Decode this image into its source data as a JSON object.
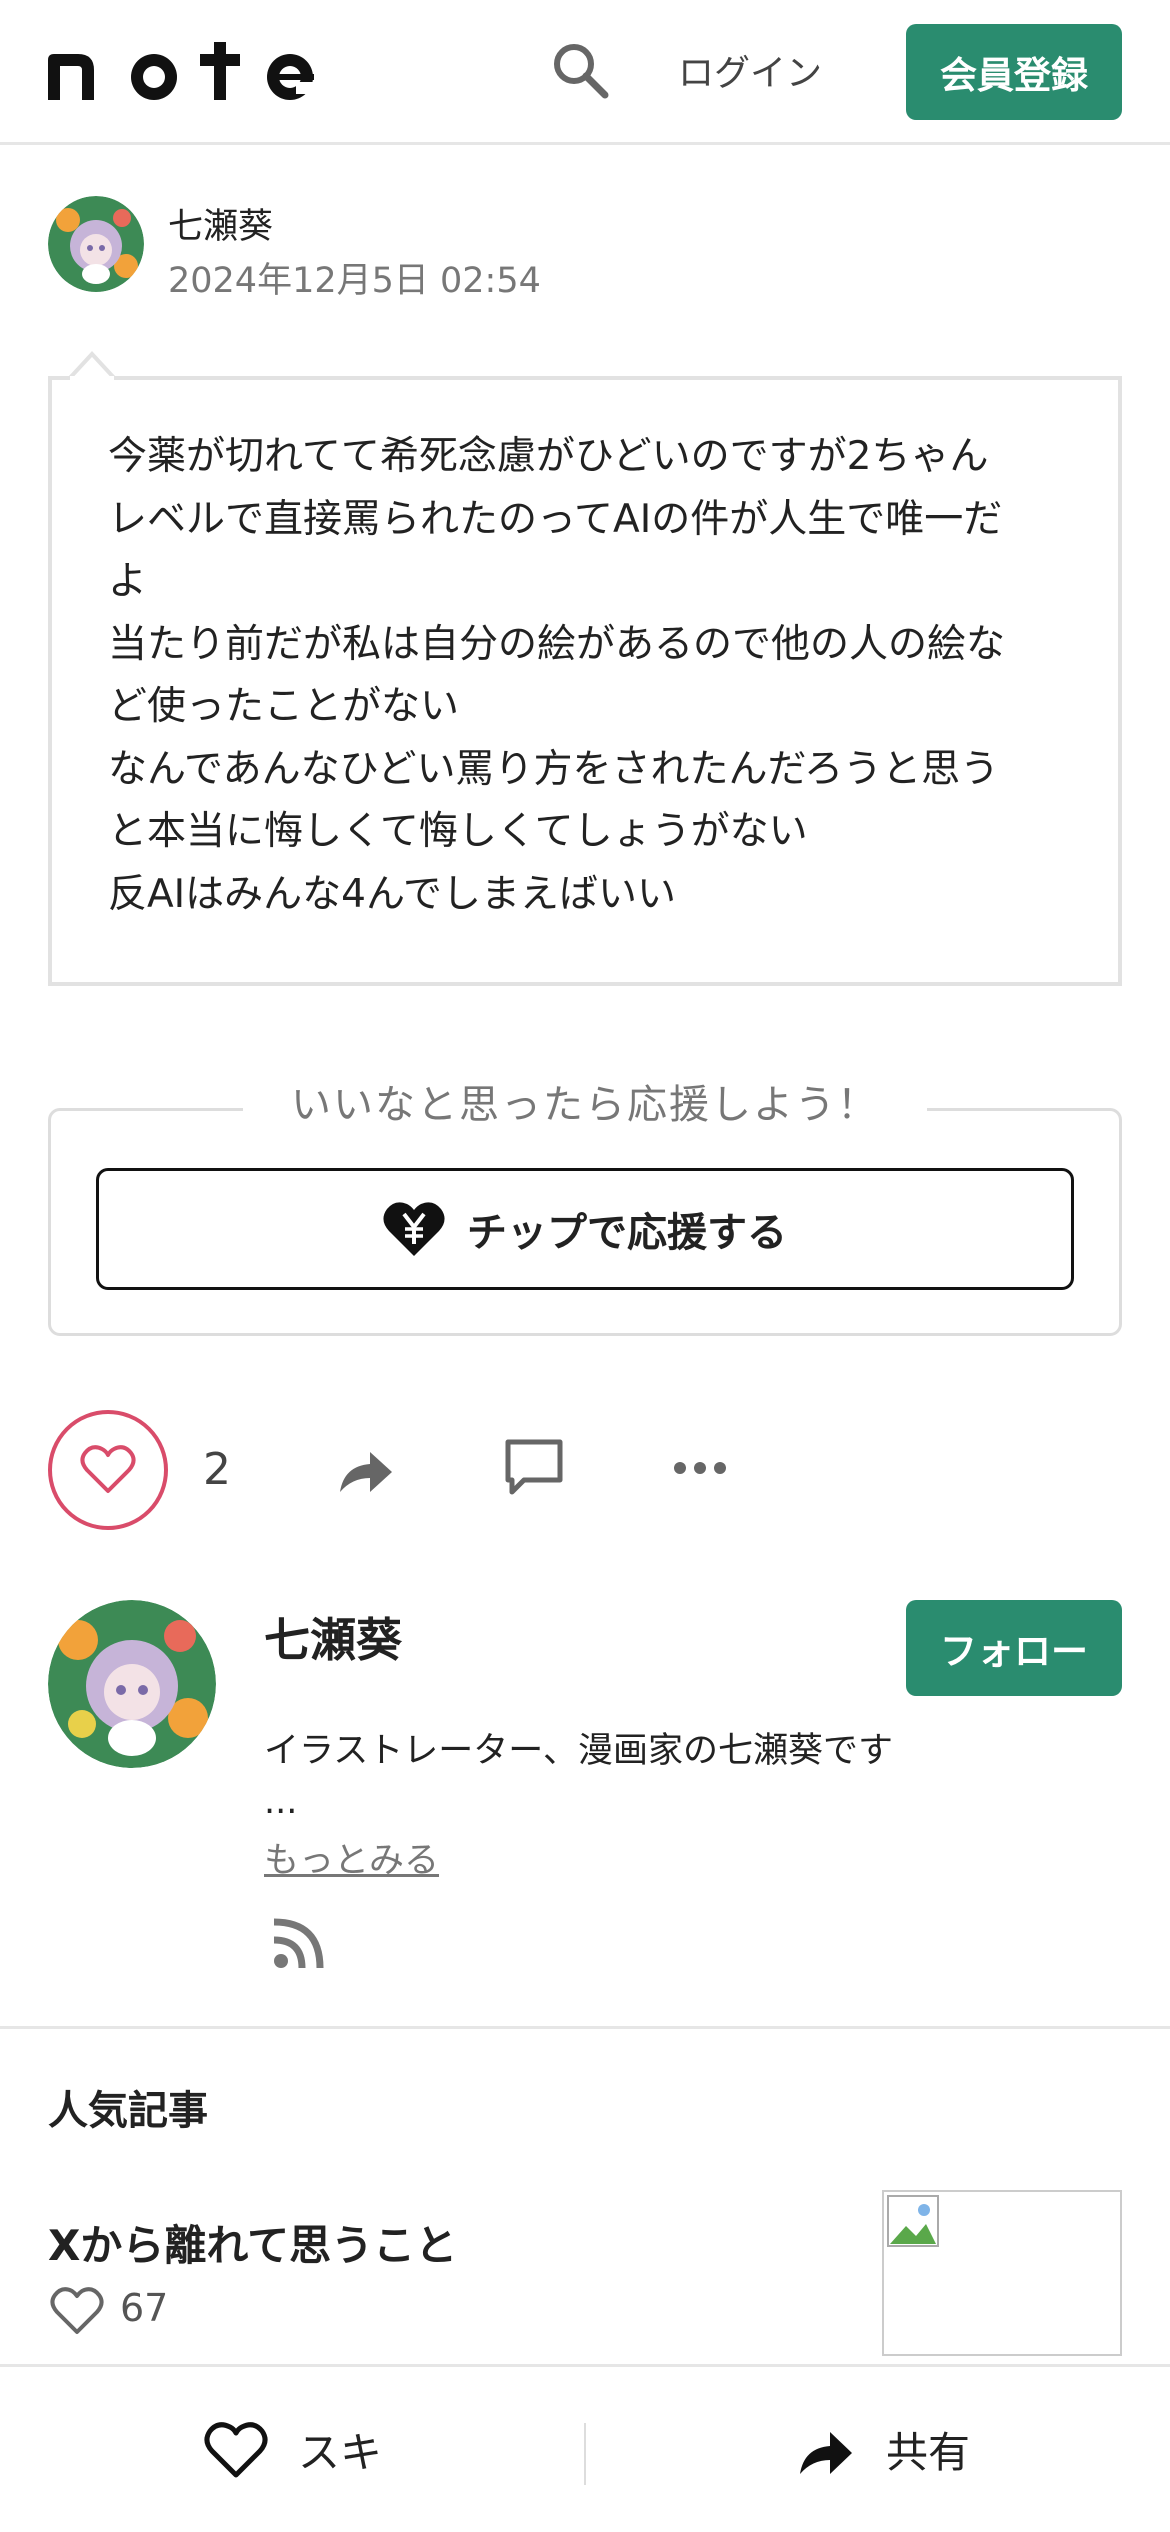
{
  "header": {
    "logo_text": "note",
    "login_label": "ログイン",
    "signup_label": "会員登録",
    "icons": {
      "search": "search-icon"
    }
  },
  "post": {
    "author_name": "七瀬葵",
    "date": "2024年12月5日 02:54",
    "lines": [
      "今薬が切れてて希死念慮がひどいのですが2ちゃん",
      "レベルで直接罵られたのってAIの件が人生で唯一だ",
      "よ",
      "当たり前だが私は自分の絵があるので他の人の絵な",
      "ど使ったことがない",
      "なんであんなひどい罵り方をされたんだろうと思う",
      "と本当に悔しくて悔しくてしょうがない",
      "反AIはみんな4んでしまえばいい"
    ]
  },
  "support": {
    "title": "いいなと思ったら応援しよう！",
    "tip_label": "チップで応援する",
    "icon": "yen-heart-icon"
  },
  "actions": {
    "like_count": "2",
    "icons": [
      "heart-icon",
      "share-icon",
      "comment-icon",
      "more-icon"
    ]
  },
  "profile": {
    "name": "七瀬葵",
    "follow_label": "フォロー",
    "bio": "イラストレーター、漫画家の七瀬葵です",
    "ellipsis": "...",
    "more_label": "もっとみる",
    "icon": "rss-icon"
  },
  "popular": {
    "section_title": "人気記事",
    "article": {
      "title": "Xから離れて思うこと",
      "likes": "67"
    }
  },
  "bottom_bar": {
    "like_label": "スキ",
    "share_label": "共有"
  },
  "colors": {
    "brand_green": "#2a8c6f",
    "like_pink": "#d94c6a",
    "border_gray": "#e2e2e2"
  }
}
